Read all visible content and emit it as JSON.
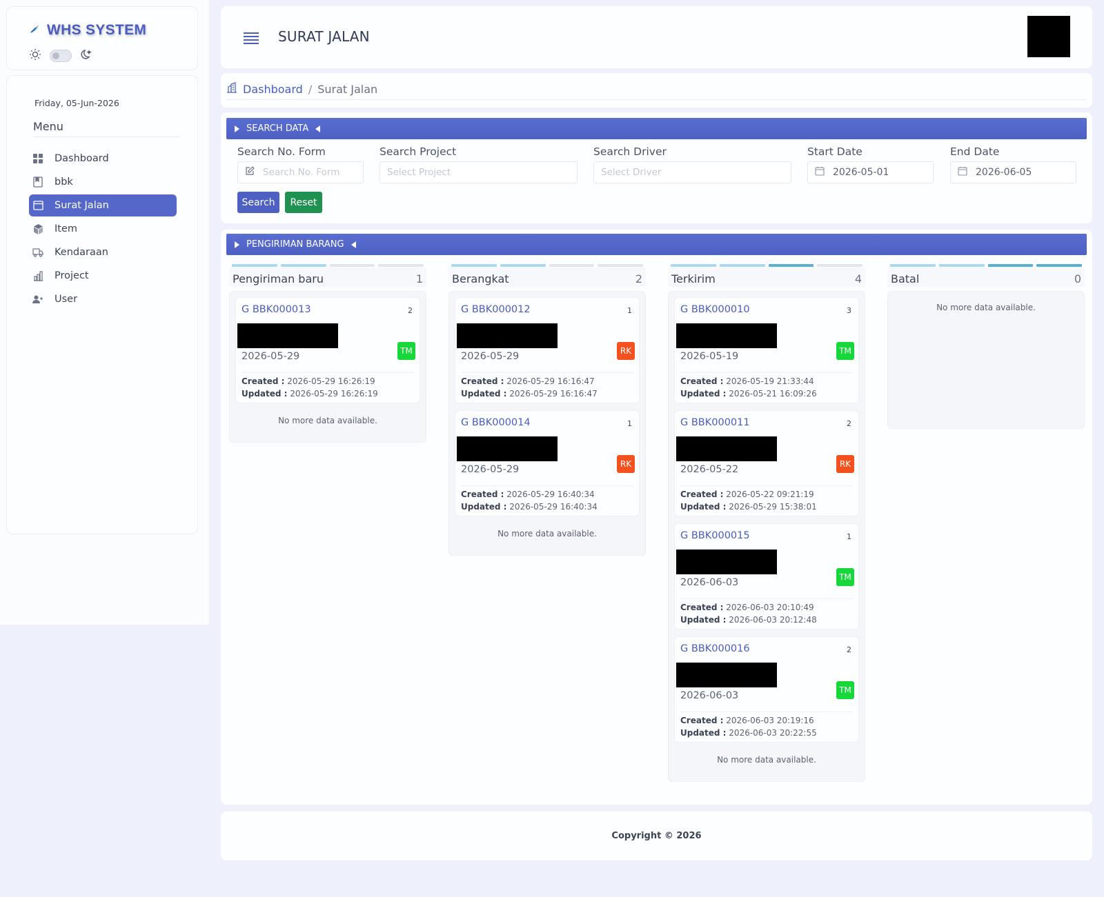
{
  "brand": {
    "title": "WHS SYSTEM"
  },
  "sidebar": {
    "date": "Friday, 05-Jun-2026",
    "menu_title": "Menu",
    "items": [
      {
        "label": "Dashboard",
        "icon": "grid-icon"
      },
      {
        "label": "bbk",
        "icon": "bookmark-icon"
      },
      {
        "label": "Surat Jalan",
        "icon": "window-icon"
      },
      {
        "label": "Item",
        "icon": "box-icon"
      },
      {
        "label": "Kendaraan",
        "icon": "truck-icon"
      },
      {
        "label": "Project",
        "icon": "chart-icon"
      },
      {
        "label": "User",
        "icon": "user-add-icon"
      }
    ]
  },
  "header": {
    "title": "SURAT JALAN"
  },
  "breadcrumb": {
    "home": "Dashboard",
    "sep": "/",
    "current": "Surat Jalan"
  },
  "search": {
    "section_title": "SEARCH DATA",
    "fields": {
      "no_form": {
        "label": "Search No. Form",
        "placeholder": "Search No. Form"
      },
      "project": {
        "label": "Search Project",
        "placeholder": "Select Project"
      },
      "driver": {
        "label": "Search Driver",
        "placeholder": "Select Driver"
      },
      "start": {
        "label": "Start Date",
        "value": "2026-05-01"
      },
      "end": {
        "label": "End Date",
        "value": "2026-06-05"
      }
    },
    "search_label": "Search",
    "reset_label": "Reset"
  },
  "kanban": {
    "section_title": "PENGIRIMAN BARANG",
    "no_more": "No more data available.",
    "created_label": "Created :",
    "updated_label": "Updated :",
    "columns": [
      {
        "title": "Pengiriman baru",
        "count": "1",
        "tasks": [
          {
            "code": "G BBK000013",
            "num": "2",
            "date": "2026-05-29",
            "badge": "TM",
            "created": "2026-05-29 16:26:19",
            "updated": "2026-05-29 16:26:19"
          }
        ]
      },
      {
        "title": "Berangkat",
        "count": "2",
        "tasks": [
          {
            "code": "G BBK000012",
            "num": "1",
            "date": "2026-05-29",
            "badge": "RK",
            "created": "2026-05-29 16:16:47",
            "updated": "2026-05-29 16:16:47"
          },
          {
            "code": "G BBK000014",
            "num": "1",
            "date": "2026-05-29",
            "badge": "RK",
            "created": "2026-05-29 16:40:34",
            "updated": "2026-05-29 16:40:34"
          }
        ]
      },
      {
        "title": "Terkirim",
        "count": "4",
        "tasks": [
          {
            "code": "G BBK000010",
            "num": "3",
            "date": "2026-05-19",
            "badge": "TM",
            "created": "2026-05-19 21:33:44",
            "updated": "2026-05-21 16:09:26"
          },
          {
            "code": "G BBK000011",
            "num": "2",
            "date": "2026-05-22",
            "badge": "RK",
            "created": "2026-05-22 09:21:19",
            "updated": "2026-05-29 15:38:01"
          },
          {
            "code": "G BBK000015",
            "num": "1",
            "date": "2026-06-03",
            "badge": "TM",
            "created": "2026-06-03 20:10:49",
            "updated": "2026-06-03 20:12:48"
          },
          {
            "code": "G BBK000016",
            "num": "2",
            "date": "2026-06-03",
            "badge": "TM",
            "created": "2026-06-03 20:19:16",
            "updated": "2026-06-03 20:22:55"
          }
        ]
      },
      {
        "title": "Batal",
        "count": "0",
        "tasks": []
      }
    ]
  },
  "footer": {
    "text": "Copyright © 2026"
  },
  "colors": {
    "primary": "#4e60c2",
    "success": "#1f9150",
    "badge_tm": "#16d83a",
    "badge_rk": "#f4511e"
  }
}
